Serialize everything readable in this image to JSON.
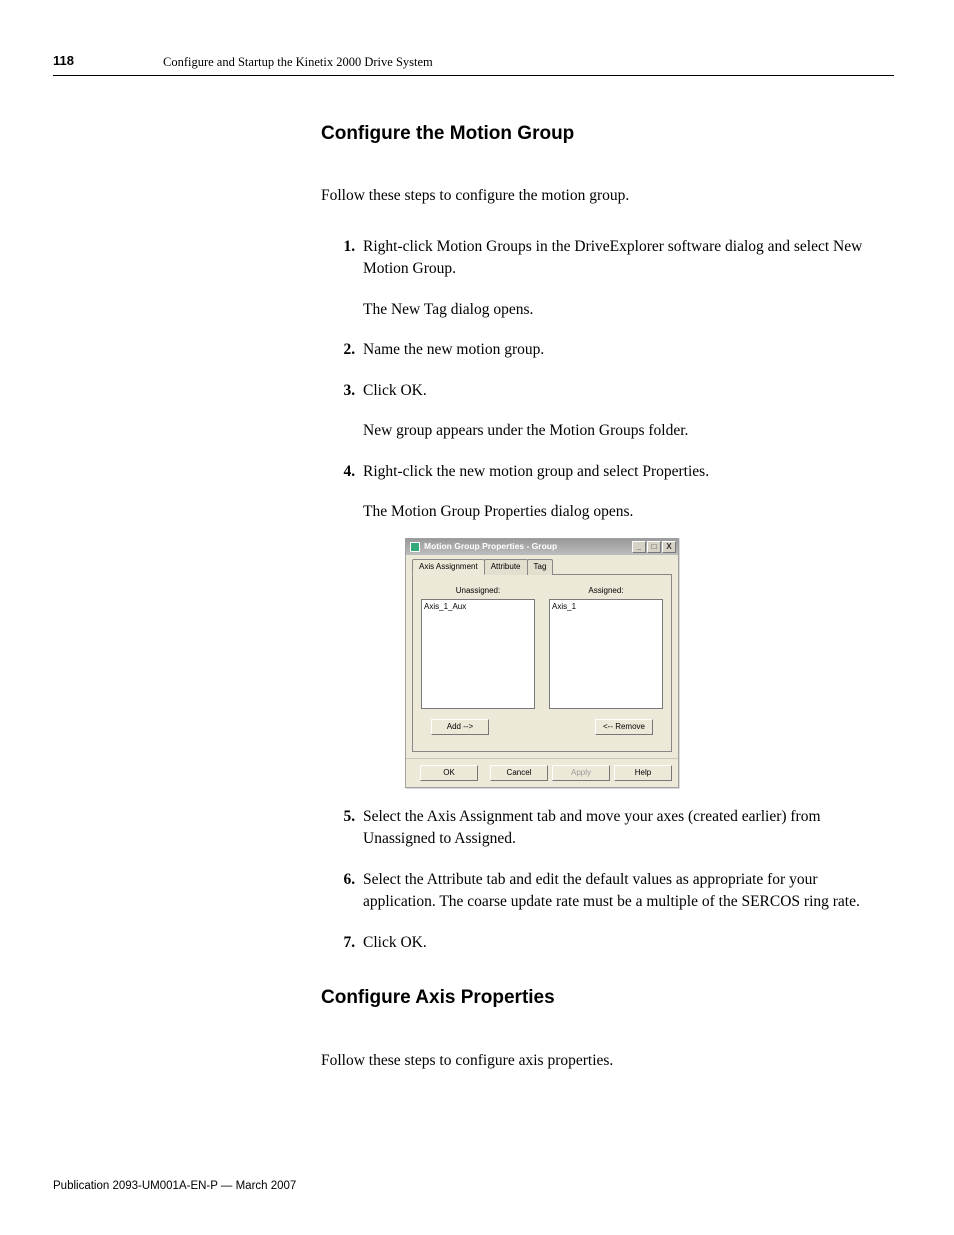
{
  "header": {
    "page_number": "118",
    "running_title": "Configure and Startup the Kinetix 2000 Drive System"
  },
  "section1": {
    "heading": "Configure the Motion Group",
    "intro": "Follow these steps to configure the motion group.",
    "steps": {
      "s1": {
        "text": "Right-click Motion Groups in the DriveExplorer software dialog and select New Motion Group.",
        "note": "The New Tag dialog opens."
      },
      "s2": {
        "text": "Name the new motion group."
      },
      "s3": {
        "text": "Click OK.",
        "note": "New group appears under the Motion Groups folder."
      },
      "s4": {
        "text": "Right-click the new motion group and select Properties.",
        "note": "The Motion Group Properties dialog opens."
      },
      "s5": {
        "text": "Select the Axis Assignment tab and move your axes (created earlier) from Unassigned to Assigned."
      },
      "s6": {
        "text": "Select the Attribute tab and edit the default values as appropriate for your application. The coarse update rate must be a multiple of the SERCOS ring rate."
      },
      "s7": {
        "text": "Click OK."
      }
    }
  },
  "dialog": {
    "title": "Motion Group Properties - Group",
    "tabs": {
      "t0": "Axis Assignment",
      "t1": "Attribute",
      "t2": "Tag"
    },
    "labels": {
      "unassigned": "Unassigned:",
      "assigned": "Assigned:"
    },
    "lists": {
      "unassigned_item": "Axis_1_Aux",
      "assigned_item": "Axis_1"
    },
    "buttons": {
      "add": "Add -->",
      "remove": "<-- Remove",
      "ok": "OK",
      "cancel": "Cancel",
      "apply": "Apply",
      "help": "Help"
    },
    "win": {
      "min": "_",
      "max": "□",
      "close": "X"
    }
  },
  "section2": {
    "heading": "Configure Axis Properties",
    "intro": "Follow these steps to configure axis properties."
  },
  "footer": "Publication 2093-UM001A-EN-P — March 2007"
}
